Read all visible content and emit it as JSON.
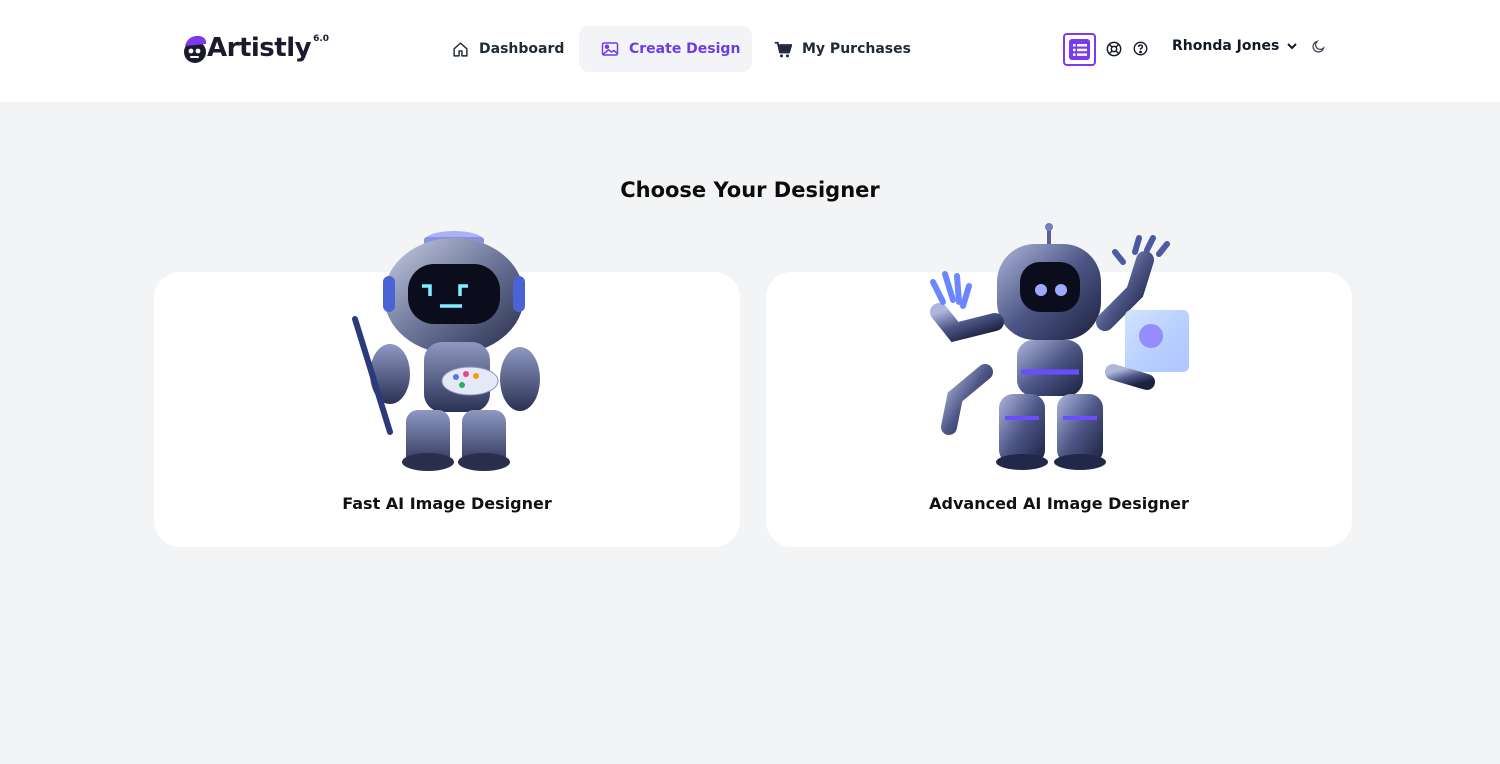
{
  "brand": {
    "name": "Artistly",
    "version": "6.0",
    "accent": "#7c3aed"
  },
  "nav": {
    "items": [
      {
        "label": "Dashboard",
        "icon": "home-icon",
        "active": false
      },
      {
        "label": "Create Design",
        "icon": "image-icon",
        "active": true
      },
      {
        "label": "My Purchases",
        "icon": "cart-icon",
        "active": false
      }
    ]
  },
  "header": {
    "user_name": "Rhonda Jones",
    "icons": [
      "list-icon",
      "support-icon",
      "help-icon",
      "chevron-down-icon",
      "moon-icon"
    ]
  },
  "main": {
    "heading": "Choose Your Designer",
    "cards": [
      {
        "label": "Fast AI Image Designer",
        "image": "robot-painter-illustration"
      },
      {
        "label": "Advanced AI Image Designer",
        "image": "robot-advanced-illustration"
      }
    ]
  },
  "colors": {
    "background": "#f3f4f6",
    "card": "#ffffff",
    "active_nav_bg": "#f3f4f8",
    "active_nav_text": "#6d3ce8"
  }
}
